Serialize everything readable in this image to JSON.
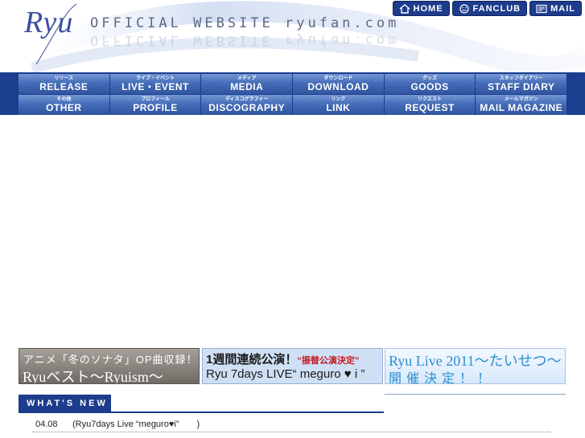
{
  "header": {
    "logo": "Ryu",
    "tagline": "OFFICIAL WEBSITE ryufan.com",
    "top_buttons": [
      {
        "label": "HOME",
        "icon": "home-icon"
      },
      {
        "label": "FANCLUB",
        "icon": "smiley-icon"
      },
      {
        "label": "MAIL",
        "icon": "mail-icon"
      }
    ]
  },
  "nav": {
    "row1": [
      {
        "jp": "リリース",
        "en": "RELEASE"
      },
      {
        "jp": "ライブ・イベント",
        "en": "LIVE・EVENT"
      },
      {
        "jp": "メディア",
        "en": "MEDIA"
      },
      {
        "jp": "ダウンロード",
        "en": "DOWNLOAD"
      },
      {
        "jp": "グッズ",
        "en": "GOODS"
      },
      {
        "jp": "スタッフダイアリー",
        "en": "STAFF DIARY"
      }
    ],
    "row2": [
      {
        "jp": "その他",
        "en": "OTHER"
      },
      {
        "jp": "プロフィール",
        "en": "PROFILE"
      },
      {
        "jp": "ディスコグラフィー",
        "en": "DISCOGRAPHY"
      },
      {
        "jp": "リンク",
        "en": "LINK"
      },
      {
        "jp": "リクエスト",
        "en": "REQUEST"
      },
      {
        "jp": "メールマガジン",
        "en": "MAIL MAGAZINE"
      }
    ]
  },
  "banners": {
    "b1": {
      "line1": "アニメ「冬のソナタ」OP曲収録！",
      "line2": "Ryuベスト〜Ryuism〜"
    },
    "b2": {
      "line1": "1週間連続公演！",
      "highlight": "“振替公演決定”",
      "line2": "Ryu 7days LIVE“ meguro ♥ i ”"
    },
    "b3": {
      "line1": "Ryu Live 2011〜たいせつ〜",
      "line2": "開催決定！！"
    }
  },
  "news": {
    "heading": "WHAT'S NEW",
    "items": [
      {
        "date": "04.08",
        "text": "(Ryu7days Live “meguro♥i”　　)"
      }
    ]
  },
  "colors": {
    "brand": "#1d3c8c",
    "nav": "#3f68b6",
    "accent_red": "#c8161d",
    "accent_blue": "#2c8fd0"
  }
}
